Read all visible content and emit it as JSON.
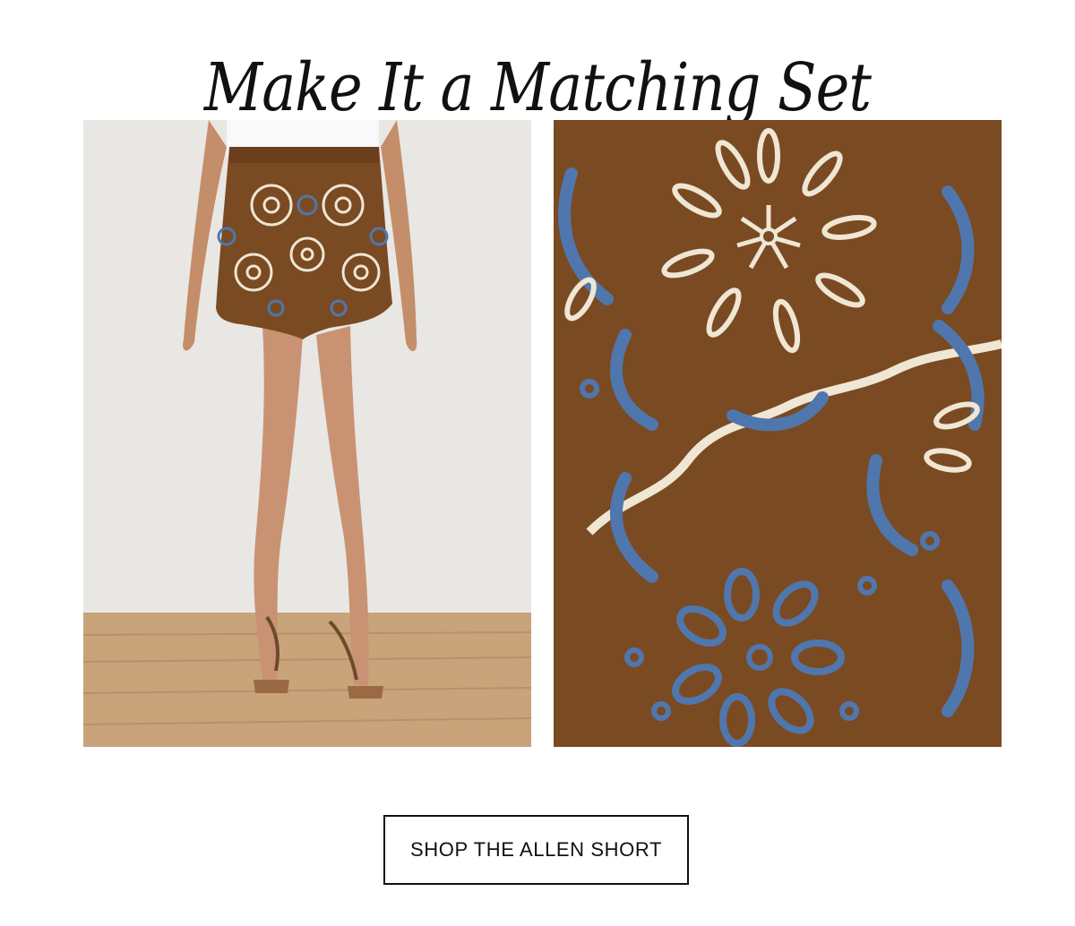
{
  "headline": {
    "text": "Make It a Matching Set"
  },
  "images": {
    "left": {
      "subject": "model-wearing-embroidered-shorts"
    },
    "right": {
      "subject": "eyelet-embroidery-fabric-closeup"
    }
  },
  "cta": {
    "label": "SHOP THE ALLEN SHORT"
  },
  "colors": {
    "text": "#111111",
    "background": "#ffffff",
    "fabric_brown": "#7a4a22",
    "embroidery_blue": "#4f77ad",
    "embroidery_cream": "#efe6d4"
  }
}
